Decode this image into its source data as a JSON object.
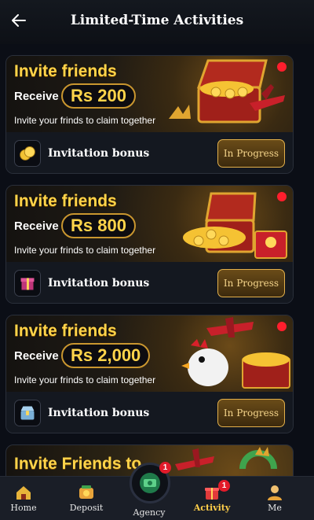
{
  "header": {
    "title": "Limited-Time Activities",
    "back_icon": "back-arrow-icon"
  },
  "cards": [
    {
      "title": "Invite friends",
      "receive_label": "Receive",
      "amount": "Rs 200",
      "subtitle": "Invite your frinds to claim together",
      "bonus_label": "Invitation bonus",
      "button_label": "In Progress",
      "icon": "gold-coin-icon",
      "has_dot": true
    },
    {
      "title": "Invite friends",
      "receive_label": "Receive",
      "amount": "Rs 800",
      "subtitle": "Invite your frinds to claim together",
      "bonus_label": "Invitation bonus",
      "button_label": "In Progress",
      "icon": "gift-box-icon",
      "has_dot": true
    },
    {
      "title": "Invite friends",
      "receive_label": "Receive",
      "amount": "Rs 2,000",
      "subtitle": "Invite your frinds to claim together",
      "bonus_label": "Invitation bonus",
      "button_label": "In Progress",
      "icon": "treasure-chest-icon",
      "has_dot": true
    }
  ],
  "peek_card": {
    "title": "Invite Friends to"
  },
  "tabbar": {
    "items": [
      {
        "label": "Home",
        "icon": "home-icon"
      },
      {
        "label": "Deposit",
        "icon": "deposit-icon"
      },
      {
        "label": "Agency",
        "icon": "agency-icon",
        "badge": "1"
      },
      {
        "label": "Activity",
        "icon": "activity-icon",
        "badge": "1",
        "active": true
      },
      {
        "label": "Me",
        "icon": "me-icon"
      }
    ]
  },
  "colors": {
    "accent_gold": "#ffd44a",
    "badge_red": "#e21b2a",
    "background": "#0b0e16"
  }
}
